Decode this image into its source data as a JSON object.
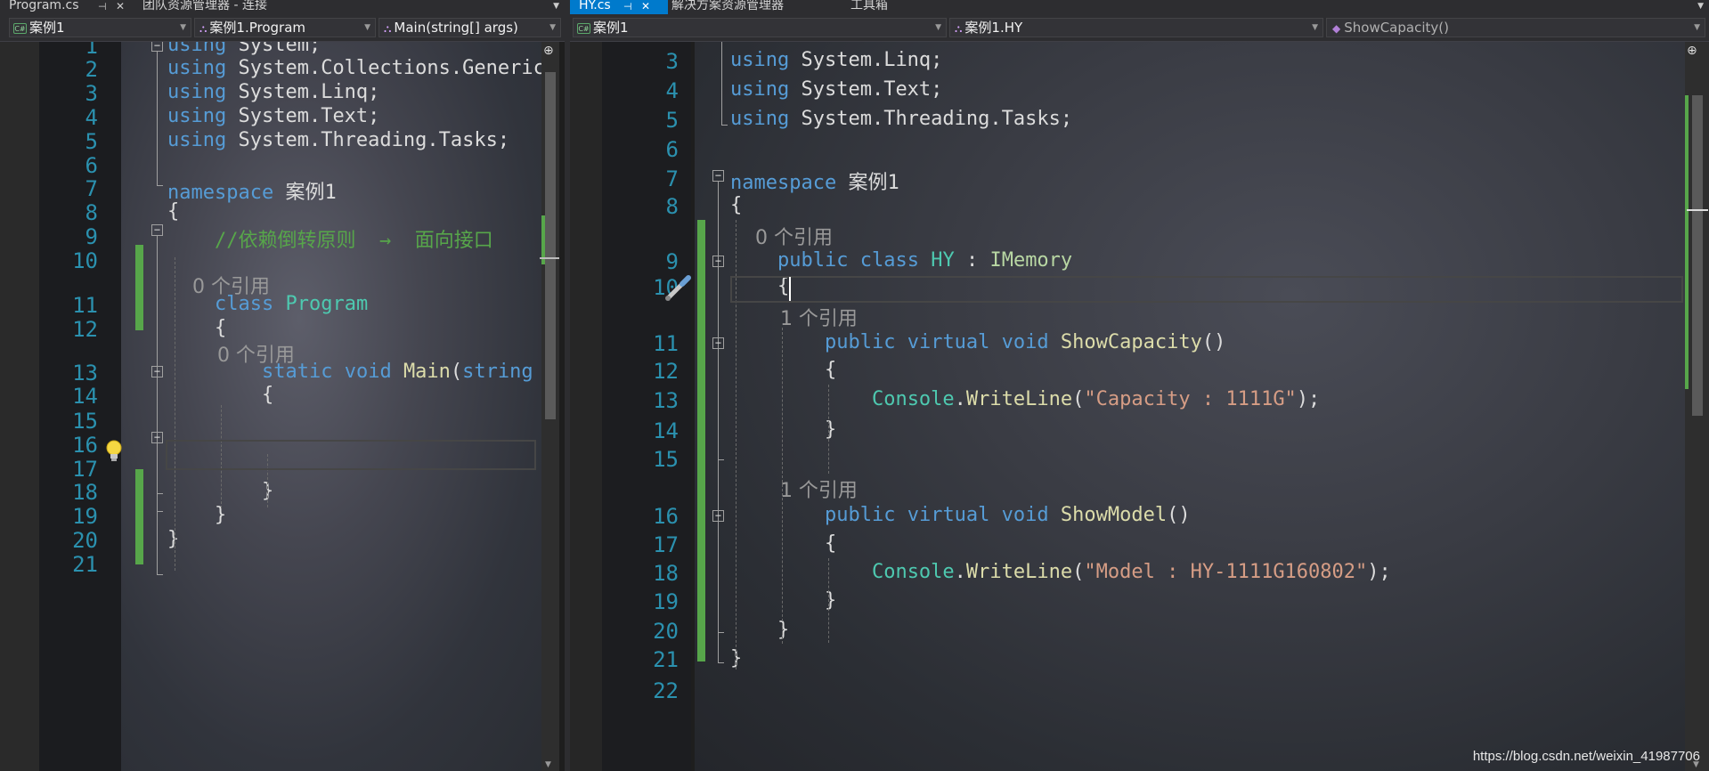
{
  "left": {
    "tabs": [
      {
        "label": "Program.cs",
        "active": false
      },
      {
        "label": "团队资源管理器 - 连接",
        "active": false
      }
    ],
    "nav": {
      "project": "案例1",
      "type": "案例1.Program",
      "member": "Main(string[] args)"
    },
    "lines": [
      {
        "n": "1",
        "code": [
          {
            "t": "using",
            "c": "kw"
          },
          {
            "t": " System;"
          }
        ]
      },
      {
        "n": "2",
        "code": [
          {
            "t": "using",
            "c": "kw"
          },
          {
            "t": " System.Collections.Generic"
          }
        ]
      },
      {
        "n": "3",
        "code": [
          {
            "t": "using",
            "c": "kw"
          },
          {
            "t": " System.Linq;"
          }
        ]
      },
      {
        "n": "4",
        "code": [
          {
            "t": "using",
            "c": "kw"
          },
          {
            "t": " System.Text;"
          }
        ]
      },
      {
        "n": "5",
        "code": [
          {
            "t": "using",
            "c": "kw"
          },
          {
            "t": " System.Threading.Tasks;"
          }
        ]
      },
      {
        "n": "6",
        "code": []
      },
      {
        "n": "7",
        "code": [
          {
            "t": "namespace",
            "c": "kw"
          },
          {
            "t": " 案例1"
          }
        ]
      },
      {
        "n": "8",
        "code": [
          {
            "t": "{"
          }
        ]
      },
      {
        "n": "9",
        "code": [
          {
            "t": "    "
          },
          {
            "t": "//依赖倒转原则  →  面向接口",
            "c": "cmt"
          }
        ]
      },
      {
        "n": "10",
        "code": []
      },
      {
        "n": "",
        "ref": "    0 个引用"
      },
      {
        "n": "11",
        "code": [
          {
            "t": "    "
          },
          {
            "t": "class",
            "c": "kw"
          },
          {
            "t": " "
          },
          {
            "t": "Program",
            "c": "ty"
          }
        ]
      },
      {
        "n": "12",
        "code": [
          {
            "t": "    {"
          }
        ]
      },
      {
        "n": "",
        "ref": "        0 个引用"
      },
      {
        "n": "13",
        "code": [
          {
            "t": "        "
          },
          {
            "t": "static",
            "c": "kw"
          },
          {
            "t": " "
          },
          {
            "t": "void",
            "c": "kw"
          },
          {
            "t": " "
          },
          {
            "t": "Main",
            "c": "fn"
          },
          {
            "t": "("
          },
          {
            "t": "string",
            "c": "kw"
          }
        ]
      },
      {
        "n": "14",
        "code": [
          {
            "t": "        {"
          }
        ]
      },
      {
        "n": "15",
        "code": []
      },
      {
        "n": "16",
        "code": []
      },
      {
        "n": "17",
        "code": []
      },
      {
        "n": "18",
        "code": [
          {
            "t": "        }"
          }
        ]
      },
      {
        "n": "19",
        "code": [
          {
            "t": "    }"
          }
        ]
      },
      {
        "n": "20",
        "code": [
          {
            "t": "}"
          }
        ]
      },
      {
        "n": "21",
        "code": []
      }
    ]
  },
  "right": {
    "tabs": [
      {
        "label": "HY.cs",
        "active": true
      },
      {
        "label": "解决方案资源管理器",
        "active": false
      },
      {
        "label": "工具箱",
        "active": false
      }
    ],
    "nav": {
      "project": "案例1",
      "type": "案例1.HY",
      "member": "ShowCapacity()"
    },
    "lines": [
      {
        "n": "3",
        "code": [
          {
            "t": "using",
            "c": "kw"
          },
          {
            "t": " System.Linq;"
          }
        ]
      },
      {
        "n": "4",
        "code": [
          {
            "t": "using",
            "c": "kw"
          },
          {
            "t": " System.Text;"
          }
        ]
      },
      {
        "n": "5",
        "code": [
          {
            "t": "using",
            "c": "kw"
          },
          {
            "t": " System.Threading.Tasks;"
          }
        ]
      },
      {
        "n": "6",
        "code": []
      },
      {
        "n": "7",
        "code": [
          {
            "t": "namespace",
            "c": "kw"
          },
          {
            "t": " 案例1"
          }
        ]
      },
      {
        "n": "8",
        "code": [
          {
            "t": "{"
          }
        ]
      },
      {
        "n": "",
        "ref": "    0 个引用"
      },
      {
        "n": "9",
        "code": [
          {
            "t": "    "
          },
          {
            "t": "public",
            "c": "kw"
          },
          {
            "t": " "
          },
          {
            "t": "class",
            "c": "kw"
          },
          {
            "t": " "
          },
          {
            "t": "HY",
            "c": "ty"
          },
          {
            "t": " : "
          },
          {
            "t": "IMemory",
            "c": "ifc"
          }
        ]
      },
      {
        "n": "10",
        "code": [
          {
            "t": "    {"
          }
        ]
      },
      {
        "n": "",
        "ref": "        1 个引用"
      },
      {
        "n": "11",
        "code": [
          {
            "t": "        "
          },
          {
            "t": "public",
            "c": "kw"
          },
          {
            "t": " "
          },
          {
            "t": "virtual",
            "c": "kw"
          },
          {
            "t": " "
          },
          {
            "t": "void",
            "c": "kw"
          },
          {
            "t": " "
          },
          {
            "t": "ShowCapacity",
            "c": "fn"
          },
          {
            "t": "()"
          }
        ]
      },
      {
        "n": "12",
        "code": [
          {
            "t": "        {"
          }
        ]
      },
      {
        "n": "13",
        "code": [
          {
            "t": "            "
          },
          {
            "t": "Console",
            "c": "ty"
          },
          {
            "t": "."
          },
          {
            "t": "WriteLine",
            "c": "fn"
          },
          {
            "t": "("
          },
          {
            "t": "\"Capacity : 1111G\"",
            "c": "str"
          },
          {
            "t": ");"
          }
        ]
      },
      {
        "n": "14",
        "code": [
          {
            "t": "        }"
          }
        ]
      },
      {
        "n": "15",
        "code": []
      },
      {
        "n": "",
        "ref": "        1 个引用"
      },
      {
        "n": "16",
        "code": [
          {
            "t": "        "
          },
          {
            "t": "public",
            "c": "kw"
          },
          {
            "t": " "
          },
          {
            "t": "virtual",
            "c": "kw"
          },
          {
            "t": " "
          },
          {
            "t": "void",
            "c": "kw"
          },
          {
            "t": " "
          },
          {
            "t": "ShowModel",
            "c": "fn"
          },
          {
            "t": "()"
          }
        ]
      },
      {
        "n": "17",
        "code": [
          {
            "t": "        {"
          }
        ]
      },
      {
        "n": "18",
        "code": [
          {
            "t": "            "
          },
          {
            "t": "Console",
            "c": "ty"
          },
          {
            "t": "."
          },
          {
            "t": "WriteLine",
            "c": "fn"
          },
          {
            "t": "("
          },
          {
            "t": "\"Model : HY-1111G160802\"",
            "c": "str"
          },
          {
            "t": ");"
          }
        ]
      },
      {
        "n": "19",
        "code": [
          {
            "t": "        }"
          }
        ]
      },
      {
        "n": "20",
        "code": [
          {
            "t": "    }"
          }
        ]
      },
      {
        "n": "21",
        "code": [
          {
            "t": "}"
          }
        ]
      },
      {
        "n": "22",
        "code": []
      }
    ]
  },
  "watermark": "https://blog.csdn.net/weixin_41987706",
  "colors": {
    "accent": "#007acc",
    "keyword": "#569cd6",
    "comment": "#57a64a",
    "type": "#4ec9b0",
    "string": "#d69d85",
    "lineNumber": "#2b91af"
  },
  "icons": [
    "pin-icon",
    "close-icon",
    "csharp-project-icon",
    "class-icon",
    "method-icon",
    "lightbulb-icon",
    "brush-icon",
    "split-editor-icon"
  ]
}
